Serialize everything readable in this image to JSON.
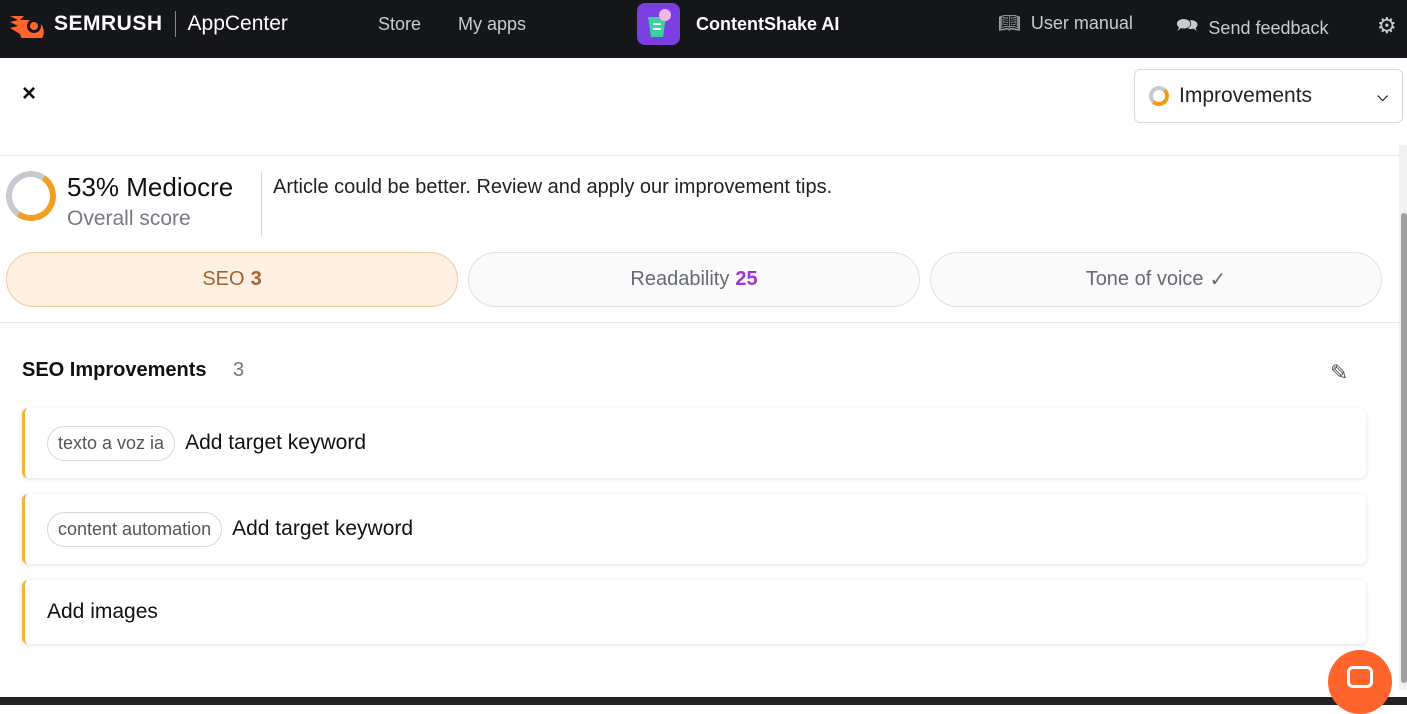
{
  "topbar": {
    "brand": "SEMRUSH",
    "product": "AppCenter",
    "nav": [
      "Store",
      "My apps"
    ],
    "app_name": "ContentShake AI",
    "user_manual": "User manual",
    "send_feedback": "Send feedback"
  },
  "panel": {
    "close": "×",
    "dropdown_label": "Improvements"
  },
  "score": {
    "title": "53% Mediocre",
    "subtitle": "Overall score",
    "value_percent": 53,
    "message": "Article could be better. Review and apply our improvement tips."
  },
  "tabs": [
    {
      "label": "SEO",
      "count": "3",
      "active": true
    },
    {
      "label": "Readability",
      "count": "25"
    },
    {
      "label": "Tone of voice",
      "check": "✓"
    }
  ],
  "section": {
    "title": "SEO Improvements",
    "count": "3"
  },
  "items": [
    {
      "chip": "texto a voz ia",
      "text": "Add target keyword"
    },
    {
      "chip": "content automation",
      "text": "Add target keyword"
    },
    {
      "text": "Add images"
    }
  ],
  "colors": {
    "accent": "#f0a020",
    "brand": "#ff642d",
    "purple": "#a236c8"
  }
}
